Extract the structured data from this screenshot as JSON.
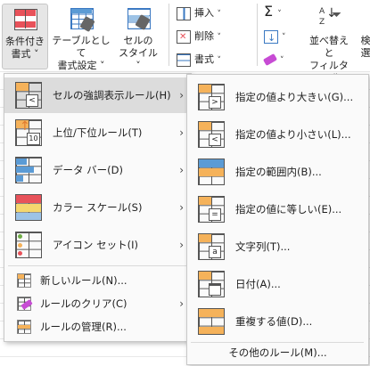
{
  "colors": {
    "accent": "#f5b25a",
    "blue": "#5b9bd5",
    "red": "#e8525a",
    "green": "#70ad47",
    "selection": "#dcdcdc"
  },
  "ribbon": {
    "conditional_format": {
      "line1": "条件付き",
      "line2": "書式 ˅"
    },
    "format_as_table": {
      "line1": "テーブルとして",
      "line2": "書式設定 ˅"
    },
    "cell_styles": {
      "line1": "セルの",
      "line2": "スタイル ˅"
    },
    "insert": "挿入",
    "delete": "削除",
    "format": "書式",
    "sort_filter": {
      "line1": "並べ替えと",
      "line2": "フィルター ˅"
    },
    "find_partial": {
      "line1": "検",
      "line2": "選"
    }
  },
  "main_menu": {
    "items": [
      {
        "label": "セルの強調表示ルール(H)",
        "icon": "highlight-cells-icon",
        "submenu": true
      },
      {
        "label": "上位/下位ルール(T)",
        "icon": "top-bottom-icon",
        "submenu": true
      },
      {
        "label": "データ バー(D)",
        "icon": "data-bars-icon",
        "submenu": true
      },
      {
        "label": "カラー スケール(S)",
        "icon": "color-scales-icon",
        "submenu": true
      },
      {
        "label": "アイコン セット(I)",
        "icon": "icon-sets-icon",
        "submenu": true
      }
    ],
    "actions": [
      {
        "label": "新しいルール(N)...",
        "icon": "new-rule-icon"
      },
      {
        "label": "ルールのクリア(C)",
        "icon": "clear-rules-icon",
        "submenu": true
      },
      {
        "label": "ルールの管理(R)...",
        "icon": "manage-rules-icon"
      }
    ]
  },
  "sub_menu": {
    "items": [
      {
        "label": "指定の値より大きい(G)...",
        "icon": "greater-than-icon"
      },
      {
        "label": "指定の値より小さい(L)...",
        "icon": "less-than-icon"
      },
      {
        "label": "指定の範囲内(B)...",
        "icon": "between-icon"
      },
      {
        "label": "指定の値に等しい(E)...",
        "icon": "equal-to-icon"
      },
      {
        "label": "文字列(T)...",
        "icon": "text-contains-icon"
      },
      {
        "label": "日付(A)...",
        "icon": "date-occurring-icon"
      },
      {
        "label": "重複する値(D)...",
        "icon": "duplicate-values-icon"
      }
    ],
    "more": "その他のルール(M)..."
  }
}
